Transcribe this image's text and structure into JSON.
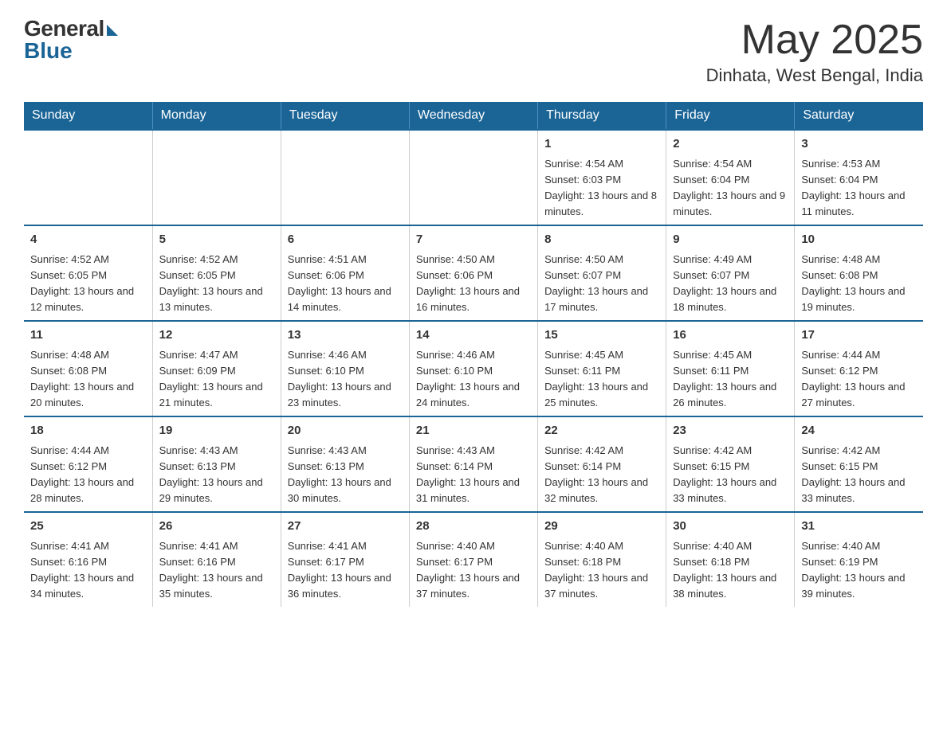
{
  "header": {
    "logo_general": "General",
    "logo_blue": "Blue",
    "month_title": "May 2025",
    "location": "Dinhata, West Bengal, India"
  },
  "weekdays": [
    "Sunday",
    "Monday",
    "Tuesday",
    "Wednesday",
    "Thursday",
    "Friday",
    "Saturday"
  ],
  "weeks": [
    [
      {
        "day": "",
        "info": ""
      },
      {
        "day": "",
        "info": ""
      },
      {
        "day": "",
        "info": ""
      },
      {
        "day": "",
        "info": ""
      },
      {
        "day": "1",
        "info": "Sunrise: 4:54 AM\nSunset: 6:03 PM\nDaylight: 13 hours and 8 minutes."
      },
      {
        "day": "2",
        "info": "Sunrise: 4:54 AM\nSunset: 6:04 PM\nDaylight: 13 hours and 9 minutes."
      },
      {
        "day": "3",
        "info": "Sunrise: 4:53 AM\nSunset: 6:04 PM\nDaylight: 13 hours and 11 minutes."
      }
    ],
    [
      {
        "day": "4",
        "info": "Sunrise: 4:52 AM\nSunset: 6:05 PM\nDaylight: 13 hours and 12 minutes."
      },
      {
        "day": "5",
        "info": "Sunrise: 4:52 AM\nSunset: 6:05 PM\nDaylight: 13 hours and 13 minutes."
      },
      {
        "day": "6",
        "info": "Sunrise: 4:51 AM\nSunset: 6:06 PM\nDaylight: 13 hours and 14 minutes."
      },
      {
        "day": "7",
        "info": "Sunrise: 4:50 AM\nSunset: 6:06 PM\nDaylight: 13 hours and 16 minutes."
      },
      {
        "day": "8",
        "info": "Sunrise: 4:50 AM\nSunset: 6:07 PM\nDaylight: 13 hours and 17 minutes."
      },
      {
        "day": "9",
        "info": "Sunrise: 4:49 AM\nSunset: 6:07 PM\nDaylight: 13 hours and 18 minutes."
      },
      {
        "day": "10",
        "info": "Sunrise: 4:48 AM\nSunset: 6:08 PM\nDaylight: 13 hours and 19 minutes."
      }
    ],
    [
      {
        "day": "11",
        "info": "Sunrise: 4:48 AM\nSunset: 6:08 PM\nDaylight: 13 hours and 20 minutes."
      },
      {
        "day": "12",
        "info": "Sunrise: 4:47 AM\nSunset: 6:09 PM\nDaylight: 13 hours and 21 minutes."
      },
      {
        "day": "13",
        "info": "Sunrise: 4:46 AM\nSunset: 6:10 PM\nDaylight: 13 hours and 23 minutes."
      },
      {
        "day": "14",
        "info": "Sunrise: 4:46 AM\nSunset: 6:10 PM\nDaylight: 13 hours and 24 minutes."
      },
      {
        "day": "15",
        "info": "Sunrise: 4:45 AM\nSunset: 6:11 PM\nDaylight: 13 hours and 25 minutes."
      },
      {
        "day": "16",
        "info": "Sunrise: 4:45 AM\nSunset: 6:11 PM\nDaylight: 13 hours and 26 minutes."
      },
      {
        "day": "17",
        "info": "Sunrise: 4:44 AM\nSunset: 6:12 PM\nDaylight: 13 hours and 27 minutes."
      }
    ],
    [
      {
        "day": "18",
        "info": "Sunrise: 4:44 AM\nSunset: 6:12 PM\nDaylight: 13 hours and 28 minutes."
      },
      {
        "day": "19",
        "info": "Sunrise: 4:43 AM\nSunset: 6:13 PM\nDaylight: 13 hours and 29 minutes."
      },
      {
        "day": "20",
        "info": "Sunrise: 4:43 AM\nSunset: 6:13 PM\nDaylight: 13 hours and 30 minutes."
      },
      {
        "day": "21",
        "info": "Sunrise: 4:43 AM\nSunset: 6:14 PM\nDaylight: 13 hours and 31 minutes."
      },
      {
        "day": "22",
        "info": "Sunrise: 4:42 AM\nSunset: 6:14 PM\nDaylight: 13 hours and 32 minutes."
      },
      {
        "day": "23",
        "info": "Sunrise: 4:42 AM\nSunset: 6:15 PM\nDaylight: 13 hours and 33 minutes."
      },
      {
        "day": "24",
        "info": "Sunrise: 4:42 AM\nSunset: 6:15 PM\nDaylight: 13 hours and 33 minutes."
      }
    ],
    [
      {
        "day": "25",
        "info": "Sunrise: 4:41 AM\nSunset: 6:16 PM\nDaylight: 13 hours and 34 minutes."
      },
      {
        "day": "26",
        "info": "Sunrise: 4:41 AM\nSunset: 6:16 PM\nDaylight: 13 hours and 35 minutes."
      },
      {
        "day": "27",
        "info": "Sunrise: 4:41 AM\nSunset: 6:17 PM\nDaylight: 13 hours and 36 minutes."
      },
      {
        "day": "28",
        "info": "Sunrise: 4:40 AM\nSunset: 6:17 PM\nDaylight: 13 hours and 37 minutes."
      },
      {
        "day": "29",
        "info": "Sunrise: 4:40 AM\nSunset: 6:18 PM\nDaylight: 13 hours and 37 minutes."
      },
      {
        "day": "30",
        "info": "Sunrise: 4:40 AM\nSunset: 6:18 PM\nDaylight: 13 hours and 38 minutes."
      },
      {
        "day": "31",
        "info": "Sunrise: 4:40 AM\nSunset: 6:19 PM\nDaylight: 13 hours and 39 minutes."
      }
    ]
  ]
}
